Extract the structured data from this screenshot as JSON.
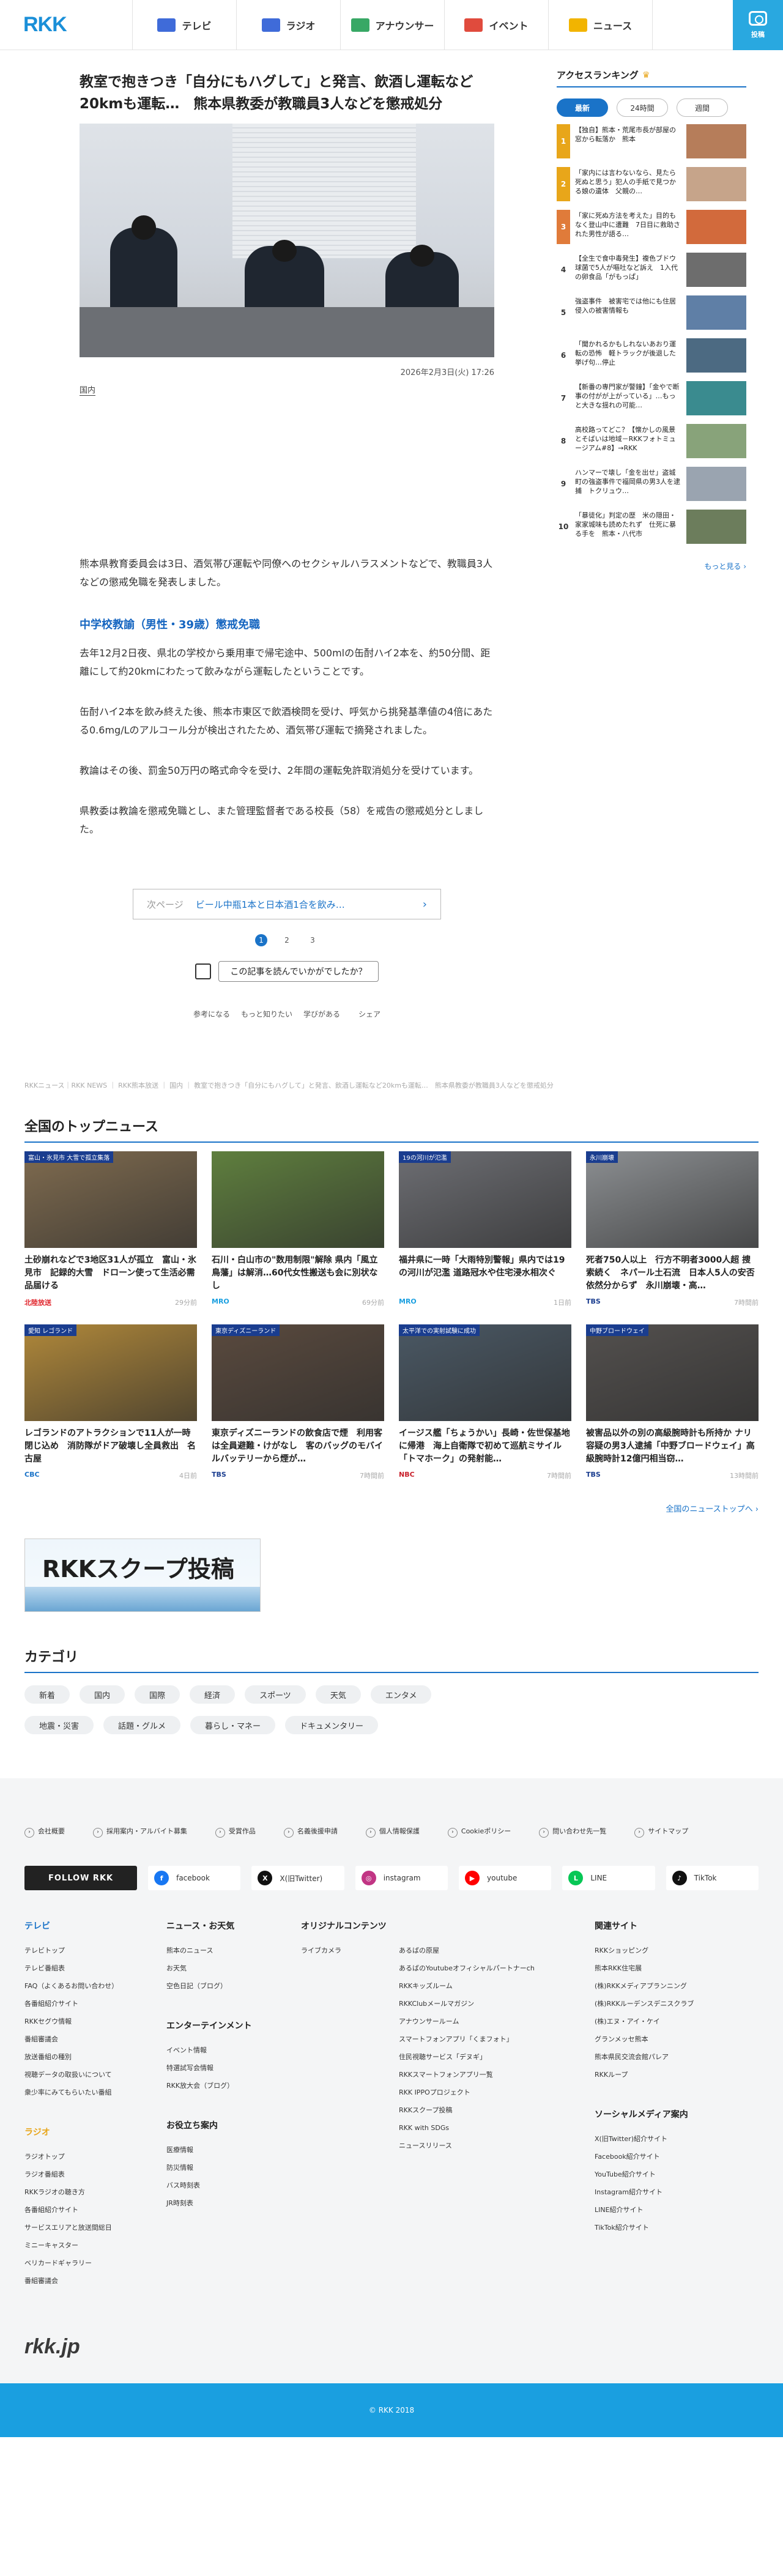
{
  "header": {
    "logo": "RKK",
    "nav": [
      {
        "label": "テレビ",
        "icon": "tv-icon",
        "color": "#3f6bd9"
      },
      {
        "label": "ラジオ",
        "icon": "radio-icon",
        "color": "#3f6bd9"
      },
      {
        "label": "アナウンサー",
        "icon": "microphone-icon",
        "color": "#38a865"
      },
      {
        "label": "イベント",
        "icon": "event-icon",
        "color": "#e04b3d"
      },
      {
        "label": "ニュース",
        "icon": "news-icon",
        "color": "#f2b400"
      }
    ],
    "post_button": "投稿"
  },
  "article": {
    "title": "教室で抱きつき「自分にもハグして」と発言、飲酒し運転など20kmも運転…　熊本県教委が教職員3人などを懲戒処分",
    "datetime": "2026年2月3日(火) 17:26",
    "category": "国内",
    "lead": "熊本県教育委員会は3日、酒気帯び運転や同僚へのセクシャルハラスメントなどで、教職員3人などの懲戒免職を発表しました。",
    "subhead": "中学校教諭（男性・39歳）懲戒免職",
    "paragraphs": [
      "去年12月2日夜、県北の学校から乗用車で帰宅途中、500mlの缶酎ハイ2本を、約50分間、距離にして約20kmにわたって飲みながら運転したということです。",
      "缶酎ハイ2本を飲み終えた後、熊本市東区で飲酒検問を受け、呼気から挑発基準値の4倍にあたる0.6mg/Lのアルコール分が検出されたため、酒気帯び運転で摘発されました。",
      "教論はその後、罰金50万円の略式命令を受け、2年間の運転免許取消処分を受けています。",
      "県教委は教論を懲戒免職とし、また管理監督者である校長（58）を戒告の懲戒処分としました。"
    ],
    "next": {
      "label": "次ページ",
      "title": "ビール中瓶1本と日本酒1合を飲み…",
      "arrow": "›"
    },
    "pages": [
      "1",
      "2",
      "3"
    ],
    "feedback": "この記事を読んでいかがでしたか？",
    "reactions": [
      "参考になる",
      "もっと知りたい",
      "学びがある",
      "シェア"
    ]
  },
  "ranking": {
    "title": "アクセスランキング",
    "tabs": [
      "最新",
      "24時間",
      "週間"
    ],
    "items": [
      {
        "num": "1",
        "text": "【独自】熊本・荒尾市長が部屋の窓から転落か　熊本",
        "rank_color": "#e8a61a",
        "thumb": "#b67d5a"
      },
      {
        "num": "2",
        "text": "「家内には言わないなら、見たら死ぬと思う」犯人の手紙で見つかる娘の遺体　父親の…",
        "rank_color": "#e8a61a",
        "thumb": "#c6a48a"
      },
      {
        "num": "3",
        "text": "「家に死ぬ方法を考えた」目的もなく登山中に遭難　7日目に救助された男性が語る…",
        "rank_color": "#e07b3a",
        "thumb": "#d26a3c"
      },
      {
        "num": "4",
        "text": "【全生で食中毒発生】複色ブドウ球菌で5人が嘔吐など訴え　1入代の卵食品「がもっぱ」",
        "rank_color": "#888888",
        "thumb": "#6d6d6d"
      },
      {
        "num": "5",
        "text": "強盗事件　被害宅では他にも住居侵入の被害情報も",
        "rank_color": "#888888",
        "thumb": "#5f7fa6"
      },
      {
        "num": "6",
        "text": "「聞かれるかもしれないあおり運転の恐怖　軽トラックが後退した挙げ句…停止",
        "rank_color": "#888888",
        "thumb": "#4c6a82"
      },
      {
        "num": "7",
        "text": "【新番の専門家が警鐘】「金やで断事の付がが上がっている」…もっと大きな揺れの可能…",
        "rank_color": "#888888",
        "thumb": "#3a8b8f"
      },
      {
        "num": "8",
        "text": "高校路ってどこ？【懐かしの風景とそばいは地域－RKKフォトミュージアム#8】→RKK",
        "rank_color": "#ffffff",
        "thumb": "#88a37a"
      },
      {
        "num": "9",
        "text": "ハンマーで壊し「金を出せ」盗城町の強盗事件で福岡県の男3人を逮捕　トクリュウ…",
        "rank_color": "#ffffff",
        "thumb": "#9aa4b0"
      },
      {
        "num": "10",
        "text": "「暴徒化」判定の歴　米の隠田・家家城味も読めたれず　仕死に暴る手を　熊本・八代市",
        "rank_color": "#ffffff",
        "thumb": "#6c7d5c"
      }
    ],
    "more": "もっと見る ›"
  },
  "breadcrumb": "RKKニュース｜RKK NEWS ｜ RKK熊本放送 ｜ 国内 ｜ 教室で抱きつき「自分にもハグして」と発言、飲酒し運転など20kmも運転…　熊本県教委が教職員3人などを懲戒処分",
  "topnews": {
    "title": "全国のトップニュース",
    "items": [
      {
        "caption": "土砂崩れなどで3地区31人が孤立　富山・氷見市　記録的大雪　ドローン使って生活必需品届ける",
        "source": "北陸放送",
        "ago": "29分前",
        "src_color": "#e0232a",
        "img": "#7f6b4f",
        "badge": "富山・氷見市 大雪で孤立集落"
      },
      {
        "caption": "石川・白山市の\"数用制限\"解除 県内「風立鳥藩」は解消…60代女性搬送も会に別状なし",
        "source": "MRO",
        "ago": "69分前",
        "src_color": "#1a9fe0",
        "img": "#5f7f3e",
        "badge": ""
      },
      {
        "caption": "福井県に一時「大雨特別警報」県内では19の河川が氾濫 道路冠水や住宅浸水相次ぐ",
        "source": "MRO",
        "ago": "1日前",
        "src_color": "#1a9fe0",
        "img": "#6d6e73",
        "badge": "19の河川が氾濫"
      },
      {
        "caption": "死者750人以上　行方不明者3000人超 捜索続く　ネパール土石流　日本人5人の安否依然分からず　永川崩壊・高…",
        "source": "TBS",
        "ago": "7時間前",
        "src_color": "#1a3d8f",
        "img": "#8c8f92",
        "badge": "永川崩壊"
      },
      {
        "caption": "レゴランドのアトラクションで11人が一時閉じ込め　消防隊がドア破壊し全員救出　名古屋",
        "source": "CBC",
        "ago": "4日前",
        "src_color": "#1a73c8",
        "img": "#b0883a",
        "badge": "愛知 レゴランド"
      },
      {
        "caption": "東京ディズニーランドの飲食店で煙　利用客は全員避難・けがなし　客のバッグのモバイルバッテリーから煙が…",
        "source": "TBS",
        "ago": "7時間前",
        "src_color": "#1a3d8f",
        "img": "#5a4a3e",
        "badge": "東京ディズニーランド"
      },
      {
        "caption": "イージス艦「ちょうかい」長崎・佐世保基地に帰港　海上自衛隊で初めて巡航ミサイル「トマホーク」の発射能…",
        "source": "NBC",
        "ago": "7時間前",
        "src_color": "#c81f2a",
        "img": "#4a5864",
        "badge": "太平洋での実射試験に成功"
      },
      {
        "caption": "被害品以外の別の高級腕時計も所持か ナリ容疑の男3人逮捕「中野ブロードウェイ」高級腕時計12億円相当窃…",
        "source": "TBS",
        "ago": "13時間前",
        "src_color": "#1a3d8f",
        "img": "#53504e",
        "badge": "中野ブロードウェイ"
      }
    ],
    "all": "全国のニューストップへ ›"
  },
  "scoop": {
    "title": "RKKスクープ投稿"
  },
  "categories": {
    "title": "カテゴリ",
    "items": [
      "新着",
      "国内",
      "国際",
      "経済",
      "スポーツ",
      "天気",
      "エンタメ",
      "地震・災害",
      "話題・グルメ",
      "暮らし・マネー",
      "ドキュメンタリー"
    ]
  },
  "footer": {
    "links": [
      "会社概要",
      "採用案内・アルバイト募集",
      "受賞作品",
      "名義後援申請",
      "個人情報保護",
      "Cookieポリシー",
      "問い合わせ先一覧",
      "サイトマップ"
    ],
    "follow": "FOLLOW RKK",
    "social": [
      {
        "label": "facebook",
        "icon": "facebook-icon",
        "color": "#1877f2",
        "glyph": "f"
      },
      {
        "label": "X(旧Twitter)",
        "icon": "x-icon",
        "color": "#111111",
        "glyph": "X"
      },
      {
        "label": "instagram",
        "icon": "instagram-icon",
        "color": "#c13584",
        "glyph": "◎"
      },
      {
        "label": "youtube",
        "icon": "youtube-icon",
        "color": "#ff0000",
        "glyph": "▶"
      },
      {
        "label": "LINE",
        "icon": "line-icon",
        "color": "#06c755",
        "glyph": "L"
      },
      {
        "label": "TikTok",
        "icon": "tiktok-icon",
        "color": "#111111",
        "glyph": "♪"
      }
    ],
    "col1": {
      "h_tv": "テレビ",
      "tv": [
        "テレビトップ",
        "テレビ番組表",
        "FAQ（よくあるお問い合わせ）",
        "各番組紹介サイト",
        "RKKセグウ情報",
        "番組審議会",
        "放送番組の種別",
        "視聴データの取扱いについて",
        "衆少率にみてもらいたい番組"
      ],
      "h_radio": "ラジオ",
      "radio": [
        "ラジオトップ",
        "ラジオ番組表",
        "RKKラジオの聴き方",
        "各番組紹介サイト",
        "サービスエリアと放送間総日",
        "ミニーキャスター",
        "ベリカードギャラリー",
        "番組審議会"
      ]
    },
    "col2": {
      "h_news": "ニュース・お天気",
      "news": [
        "熊本のニュース",
        "お天気",
        "空色日記（ブログ）"
      ],
      "h_ent": "エンターテインメント",
      "ent": [
        "イベント情報",
        "特選試写会情報",
        "RKK放大会（ブログ）"
      ],
      "h_help": "お役立ち案内",
      "help": [
        "医療情報",
        "防災情報",
        "バス時刻表",
        "JR時刻表"
      ]
    },
    "col3": {
      "h": "オリジナルコンテンツ",
      "left": [
        "ライブカメラ"
      ],
      "right": [
        "あるばの原屋",
        "あるばのYoutubeオフィシャルパートナーch",
        "RKKキッズルーム",
        "RKKClubメールマガジン",
        "アナウンサールーム",
        "スマートフォンアプリ「くまフォト」",
        "住民視聴サービス「デヌギ」",
        "RKKスマートフォンアプリ一覧",
        "RKK IPPOプロジェクト",
        "RKKスクープ投稿",
        "RKK with SDGs",
        "ニュースリリース"
      ]
    },
    "col4": {
      "h": "関連サイト",
      "rel": [
        "RKKショッピング",
        "熊本RKK住宅展",
        "(株)RKKメディアプランニング",
        "(株)RKKルーデンスデニスクラブ",
        "(株)エヌ・アイ・ケイ",
        "グランメッセ熊本",
        "熊本県民交流会館パレア",
        "RKKループ"
      ],
      "h2": "ソーシャルメディア案内",
      "sm": [
        "X(旧Twitter)紹介サイト",
        "Facebook紹介サイト",
        "YouTube紹介サイト",
        "Instagram紹介サイト",
        "LINE紹介サイト",
        "TikTok紹介サイト"
      ]
    },
    "logo": "rkk.jp",
    "copyright": "© RKK 2018"
  },
  "colors": {
    "accent": "#1a73c8",
    "brand": "#1a9fe0"
  }
}
